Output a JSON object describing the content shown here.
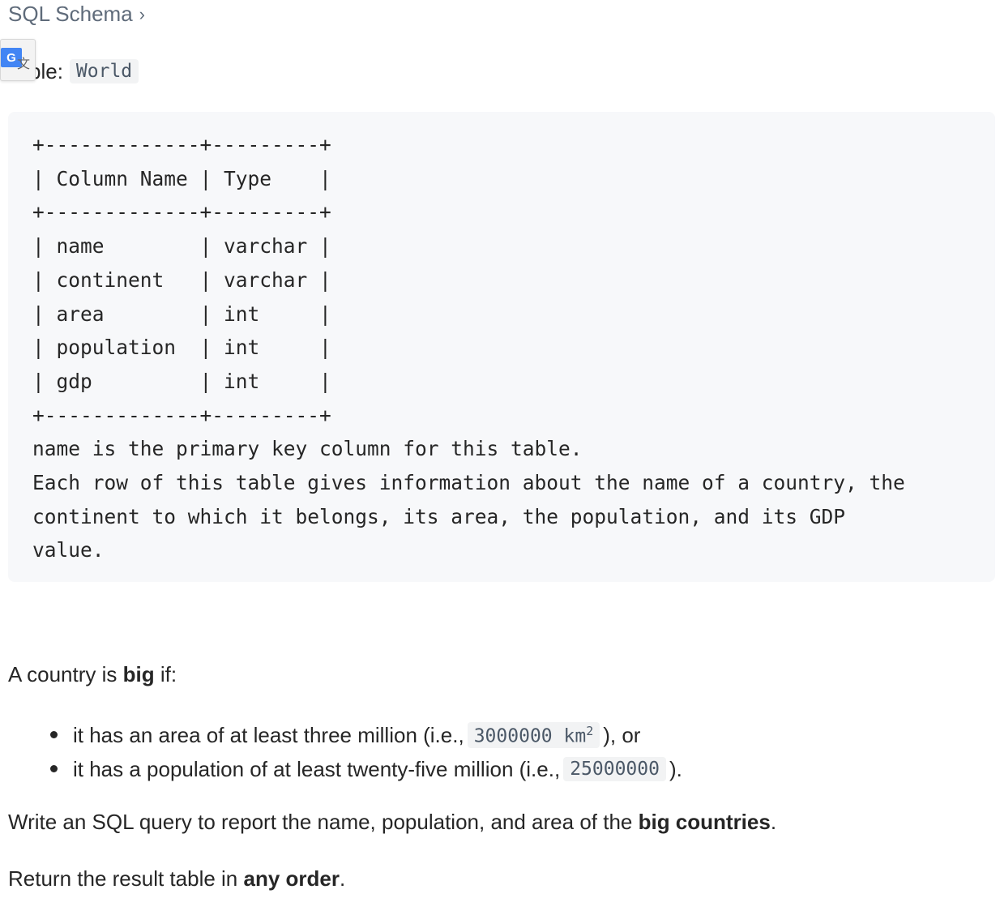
{
  "breadcrumb": {
    "label": "SQL Schema",
    "chevron": "›"
  },
  "translate_badge": {
    "icon": "google-translate-icon",
    "g_letter": "G",
    "x_char": "文"
  },
  "table_heading": {
    "label": "ble:",
    "table_name": "World"
  },
  "code_block": {
    "text": "+-------------+---------+\n| Column Name | Type    |\n+-------------+---------+\n| name        | varchar |\n| continent   | varchar |\n| area        | int     |\n| population  | int     |\n| gdp         | int     |\n+-------------+---------+\nname is the primary key column for this table.\nEach row of this table gives information about the name of a country, the\ncontinent to which it belongs, its area, the population, and its GDP\nvalue."
  },
  "description": {
    "big_intro_prefix": "A country is ",
    "big_intro_bold": "big",
    "big_intro_suffix": " if:",
    "bullets": [
      {
        "prefix": "it has an area of at least three million (i.e., ",
        "code": "3000000 km",
        "sup": "2",
        "suffix": "), or"
      },
      {
        "prefix": "it has a population of at least twenty-five million (i.e., ",
        "code": "25000000",
        "suffix": ")."
      }
    ],
    "task_prefix": "Write an SQL query to report the name, population, and area of the ",
    "task_bold": "big countries",
    "task_suffix": ".",
    "return_prefix": "Return the result table in ",
    "return_bold": "any order",
    "return_suffix": "."
  }
}
